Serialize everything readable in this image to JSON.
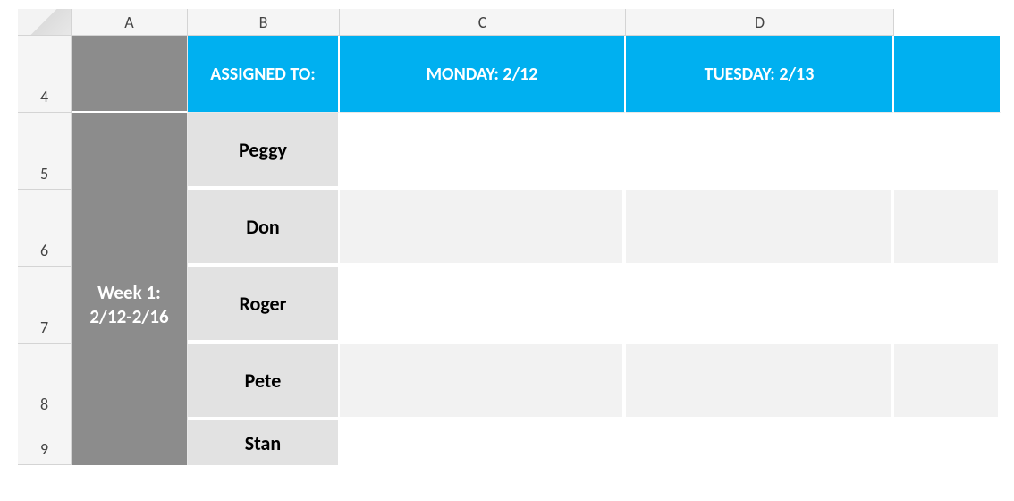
{
  "columns": {
    "A": "A",
    "B": "B",
    "C": "C",
    "D": "D"
  },
  "rows": {
    "r4": "4",
    "r5": "5",
    "r6": "6",
    "r7": "7",
    "r8": "8",
    "r9": "9"
  },
  "headers": {
    "assigned_to": "ASSIGNED TO:",
    "monday": "MONDAY: 2/12",
    "tuesday": "TUESDAY: 2/13"
  },
  "week": {
    "label": "Week 1:",
    "range": "2/12-2/16"
  },
  "people": {
    "p1": "Peggy",
    "p2": "Don",
    "p3": "Roger",
    "p4": "Pete",
    "p5": "Stan"
  }
}
